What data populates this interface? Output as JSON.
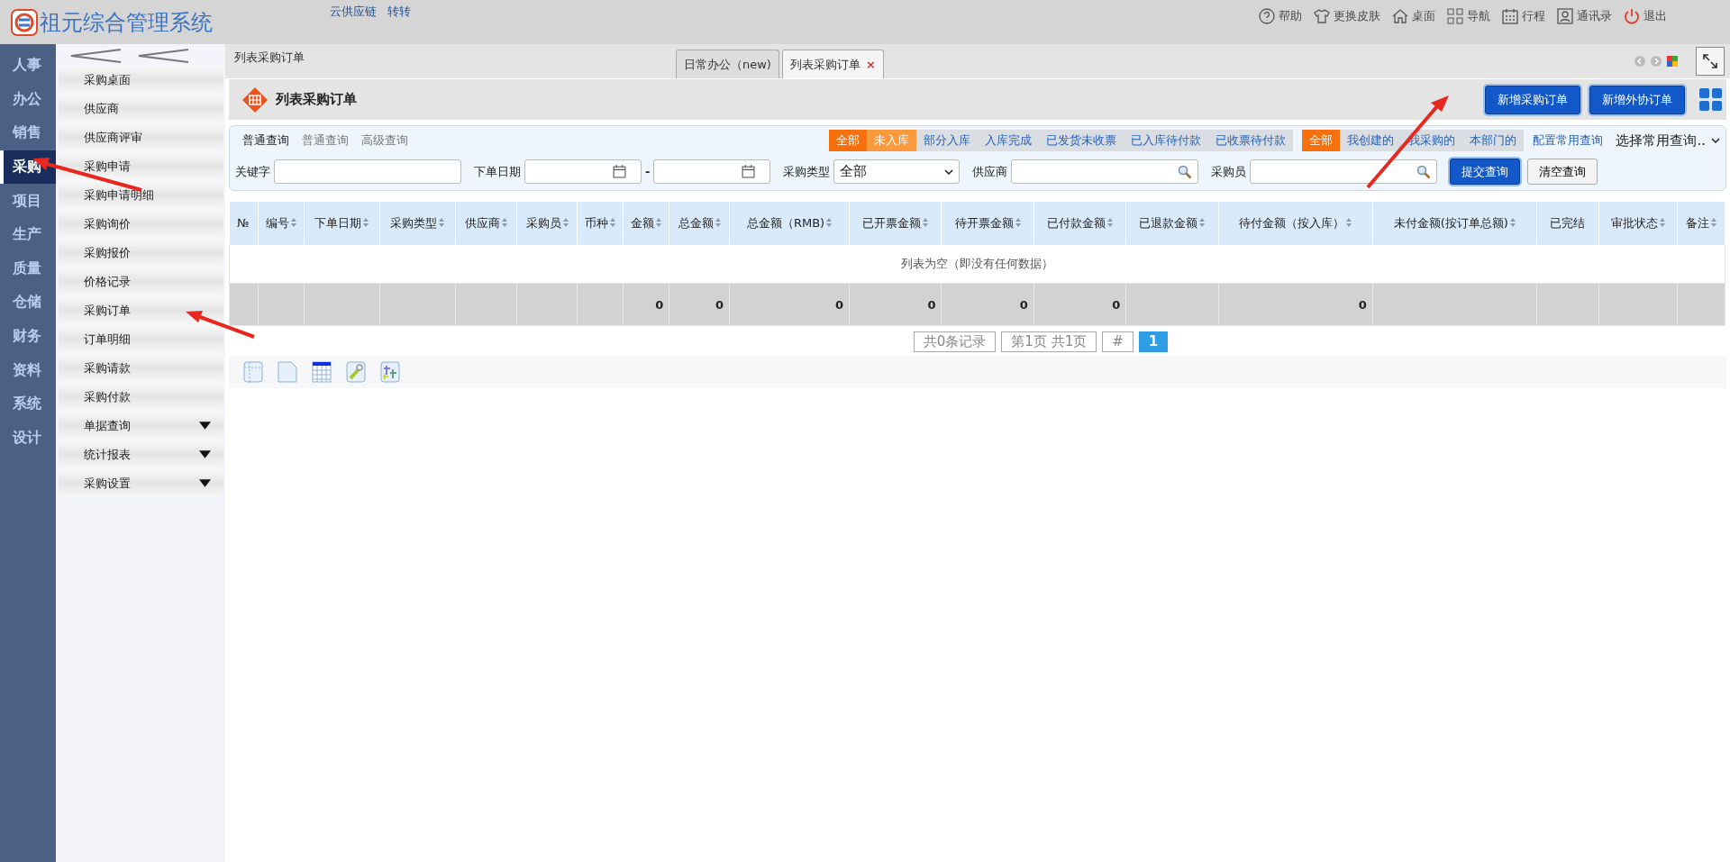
{
  "header": {
    "title": "祖元综合管理系统",
    "links": [
      "云供应链",
      "转转"
    ],
    "actions": [
      {
        "kind": "help",
        "label": "帮助"
      },
      {
        "kind": "skin",
        "label": "更换皮肤"
      },
      {
        "kind": "desktop",
        "label": "桌面"
      },
      {
        "kind": "nav",
        "label": "导航"
      },
      {
        "kind": "schedule",
        "label": "行程"
      },
      {
        "kind": "contacts",
        "label": "通讯录"
      },
      {
        "kind": "logout",
        "label": "退出"
      }
    ]
  },
  "modules": [
    {
      "label": "人事",
      "selected": false
    },
    {
      "label": "办公",
      "selected": false
    },
    {
      "label": "销售",
      "selected": false
    },
    {
      "label": "采购",
      "selected": true
    },
    {
      "label": "项目",
      "selected": false
    },
    {
      "label": "生产",
      "selected": false
    },
    {
      "label": "质量",
      "selected": false
    },
    {
      "label": "仓储",
      "selected": false
    },
    {
      "label": "财务",
      "selected": false
    },
    {
      "label": "资料",
      "selected": false
    },
    {
      "label": "系统",
      "selected": false
    },
    {
      "label": "设计",
      "selected": false
    }
  ],
  "submenu": [
    {
      "label": "采购桌面",
      "expandable": false
    },
    {
      "label": "供应商",
      "expandable": false
    },
    {
      "label": "供应商评审",
      "expandable": false
    },
    {
      "label": "采购申请",
      "expandable": false
    },
    {
      "label": "采购申请明细",
      "expandable": false
    },
    {
      "label": "采购询价",
      "expandable": false
    },
    {
      "label": "采购报价",
      "expandable": false
    },
    {
      "label": "价格记录",
      "expandable": false
    },
    {
      "label": "采购订单",
      "expandable": false
    },
    {
      "label": "订单明细",
      "expandable": false
    },
    {
      "label": "采购请款",
      "expandable": false
    },
    {
      "label": "采购付款",
      "expandable": false
    },
    {
      "label": "单据查询",
      "expandable": true
    },
    {
      "label": "统计报表",
      "expandable": true
    },
    {
      "label": "采购设置",
      "expandable": true
    }
  ],
  "breadcrumb": "列表采购订单",
  "tabs": [
    {
      "label": "日常办公（new)",
      "selected": false,
      "closable": false
    },
    {
      "label": "列表采购订单",
      "selected": true,
      "closable": true
    }
  ],
  "close_glyph": "×",
  "page_title": "列表采购订单",
  "page_buttons": [
    "新增采购订单",
    "新增外协订单"
  ],
  "query_modes": [
    {
      "label": "普通查询",
      "selected": true
    },
    {
      "label": "普通查询",
      "selected": false
    },
    {
      "label": "高级查询",
      "selected": false
    }
  ],
  "status_groups": [
    [
      {
        "kind": "all",
        "label": "全部",
        "selected": true
      },
      {
        "kind": "option",
        "label": "未入库",
        "selected": true
      },
      {
        "kind": "option",
        "label": "部分入库",
        "selected": false
      },
      {
        "kind": "option",
        "label": "入库完成",
        "selected": false
      },
      {
        "kind": "option",
        "label": "已发货未收票",
        "selected": false
      },
      {
        "kind": "option",
        "label": "已入库待付款",
        "selected": false
      },
      {
        "kind": "option",
        "label": "已收票待付款",
        "selected": false
      }
    ],
    [
      {
        "kind": "all",
        "label": "全部",
        "selected": true
      },
      {
        "kind": "option",
        "label": "我创建的",
        "selected": false
      },
      {
        "kind": "option",
        "label": "我采购的",
        "selected": false
      },
      {
        "kind": "option",
        "label": "本部门的",
        "selected": false
      }
    ]
  ],
  "config_link": "配置常用查询",
  "saved_query": {
    "value": "选择常用查询.."
  },
  "filters": {
    "keyword_label": "关键字",
    "date_label": "下单日期",
    "date_separator": "-",
    "type_label": "采购类型",
    "type_value": "全部",
    "supplier_label": "供应商",
    "buyer_label": "采购员",
    "submit": "提交查询",
    "clear": "清空查询"
  },
  "table": {
    "columns": [
      {
        "label": "№",
        "sortable": false
      },
      {
        "label": "编号",
        "sortable": true
      },
      {
        "label": "下单日期",
        "sortable": true
      },
      {
        "label": "采购类型",
        "sortable": true
      },
      {
        "label": "供应商",
        "sortable": true
      },
      {
        "label": "采购员",
        "sortable": true
      },
      {
        "label": "币种",
        "sortable": true
      },
      {
        "label": "金额",
        "sortable": true,
        "total": "0"
      },
      {
        "label": "总金额",
        "sortable": true,
        "total": "0"
      },
      {
        "label": "总金额（RMB)",
        "sortable": true,
        "total": "0"
      },
      {
        "label": "已开票金额",
        "sortable": true,
        "total": "0"
      },
      {
        "label": "待开票金额",
        "sortable": true,
        "total": "0"
      },
      {
        "label": "已付款金额",
        "sortable": true,
        "total": "0"
      },
      {
        "label": "已退款金额",
        "sortable": true
      },
      {
        "label": "待付金额（按入库）",
        "sortable": true,
        "total": "0"
      },
      {
        "label": "未付金额(按订单总额)",
        "sortable": true
      },
      {
        "label": "已完结",
        "sortable": false
      },
      {
        "label": "审批状态",
        "sortable": true
      },
      {
        "label": "备注",
        "sortable": true
      }
    ],
    "empty_text": "列表为空（即没有任何数据）"
  },
  "pagination": {
    "summary": "共0条记录",
    "page_info": "第1页 共1页",
    "jump": "#",
    "pages": [
      {
        "label": "1",
        "selected": true
      }
    ]
  }
}
